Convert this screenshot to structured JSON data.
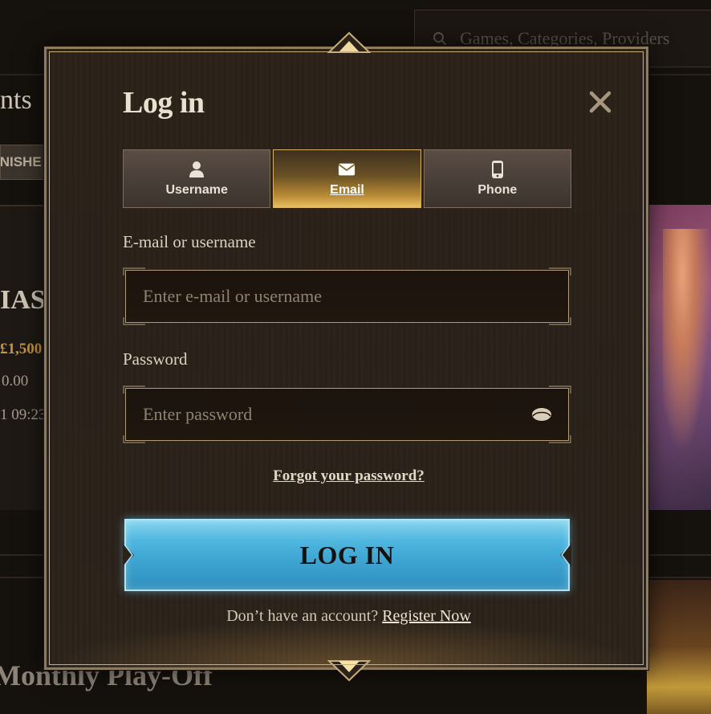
{
  "background": {
    "search_placeholder": "Games, Categories, Providers",
    "section_title_fragment": "nts",
    "finished_tab_fragment": "INISHE",
    "promo_title_fragment": "IAS",
    "prize_fragment": "£1,500",
    "balance_fragment": "0.00",
    "time_fragment": "1 09:23",
    "monthly_title": "Monthly Play-Off"
  },
  "modal": {
    "title": "Log in",
    "close_icon": "close-icon",
    "tabs": [
      {
        "label": "Username",
        "icon": "user-icon",
        "active": false
      },
      {
        "label": "Email",
        "icon": "envelope-icon",
        "active": true
      },
      {
        "label": "Phone",
        "icon": "phone-icon",
        "active": false
      }
    ],
    "email_label": "E-mail or username",
    "email_placeholder": "Enter e-mail or username",
    "password_label": "Password",
    "password_placeholder": "Enter password",
    "forgot_link": "Forgot your password?",
    "login_button": "LOG IN",
    "register_prompt": "Don’t have an account?",
    "register_link": "Register Now"
  },
  "colors": {
    "accent_gold": "#d7b064",
    "login_blue": "#4fb6df",
    "frame": "#8e7b5c"
  }
}
